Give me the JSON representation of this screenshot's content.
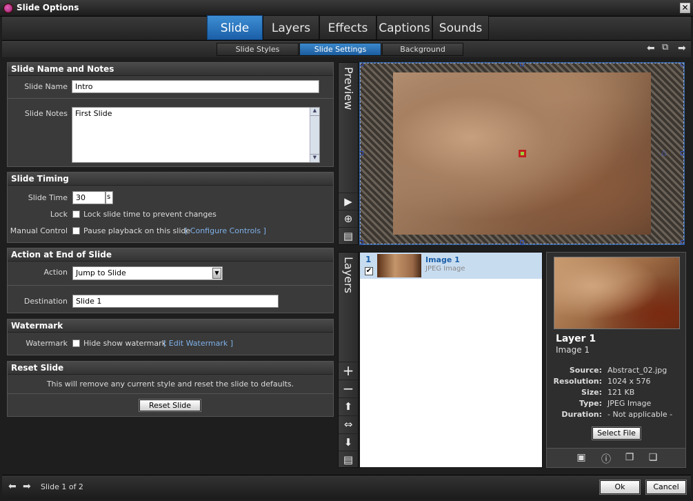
{
  "window": {
    "title": "Slide Options",
    "close": "✕"
  },
  "main_tabs": [
    "Slide",
    "Layers",
    "Effects",
    "Captions",
    "Sounds"
  ],
  "sub_tabs": [
    "Slide Styles",
    "Slide Settings",
    "Background"
  ],
  "nav_icons": [
    "arrow-left-icon",
    "popout-icon",
    "arrow-right-icon"
  ],
  "sections": {
    "name_notes": {
      "title": "Slide Name and Notes",
      "name_label": "Slide Name",
      "name_value": "Intro",
      "notes_label": "Slide Notes",
      "notes_value": "First Slide"
    },
    "timing": {
      "title": "Slide Timing",
      "time_label": "Slide Time",
      "time_value": "30",
      "time_unit": "s",
      "lock_label": "Lock",
      "lock_text": "Lock slide time to prevent changes",
      "manual_label": "Manual Control",
      "manual_text": "Pause playback on this slide",
      "configure_link": "[ Configure Controls ]"
    },
    "action": {
      "title": "Action at End of Slide",
      "action_label": "Action",
      "action_value": "Jump to Slide",
      "destination_label": "Destination",
      "destination_value": "Slide 1"
    },
    "watermark": {
      "title": "Watermark",
      "label": "Watermark",
      "text": "Hide show watermark",
      "edit_link": "[ Edit Watermark ]"
    },
    "reset": {
      "title": "Reset Slide",
      "message": "This will remove any current style and reset the slide to defaults.",
      "button": "Reset Slide"
    }
  },
  "preview": {
    "label": "Preview"
  },
  "layers": {
    "label": "Layers",
    "items": [
      {
        "number": "1",
        "name": "Image 1",
        "type": "JPEG Image",
        "checked": true
      }
    ]
  },
  "layer_info": {
    "title": "Layer 1",
    "subtitle": "Image 1",
    "fields": [
      {
        "label": "Source:",
        "value": "Abstract_02.jpg"
      },
      {
        "label": "Resolution:",
        "value": "1024 x 576"
      },
      {
        "label": "Size:",
        "value": "121 KB"
      },
      {
        "label": "Type:",
        "value": "JPEG Image"
      },
      {
        "label": "Duration:",
        "value": "- Not applicable -"
      }
    ],
    "select_button": "Select File"
  },
  "footer": {
    "slide_counter": "Slide 1 of 2",
    "ok": "Ok",
    "cancel": "Cancel"
  },
  "colors": {
    "accent": "#2a72c0",
    "link": "#7fb0e8",
    "panel": "#3a3a3a"
  }
}
